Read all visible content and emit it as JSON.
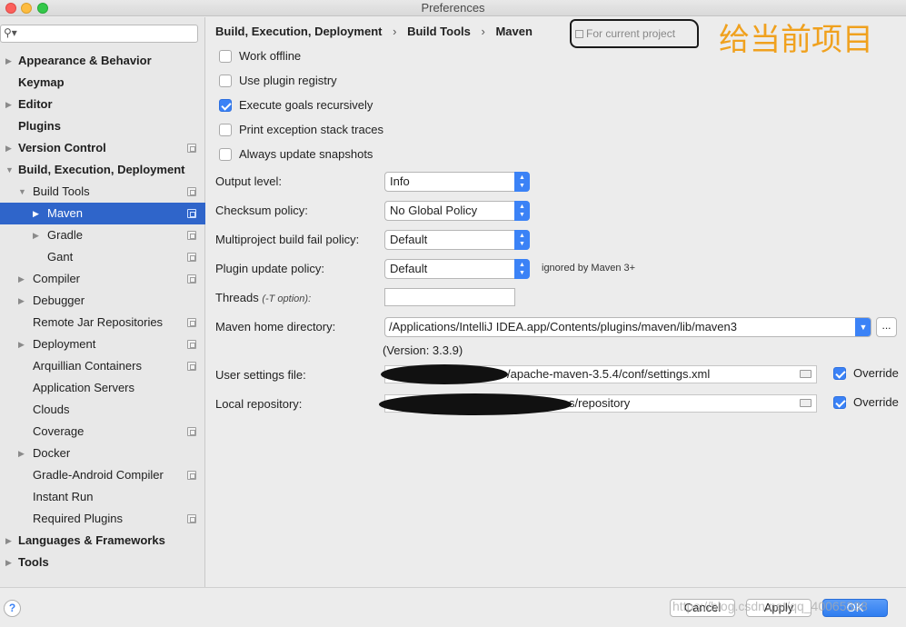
{
  "window": {
    "title": "Preferences"
  },
  "search": {
    "placeholder": ""
  },
  "sidebar": {
    "items": [
      {
        "label": "Appearance & Behavior",
        "arrow": "▶",
        "bold": true,
        "indent": 0,
        "proj": false,
        "selected": false
      },
      {
        "label": "Keymap",
        "arrow": "",
        "bold": true,
        "indent": 0,
        "proj": false,
        "selected": false
      },
      {
        "label": "Editor",
        "arrow": "▶",
        "bold": true,
        "indent": 0,
        "proj": false,
        "selected": false
      },
      {
        "label": "Plugins",
        "arrow": "",
        "bold": true,
        "indent": 0,
        "proj": false,
        "selected": false
      },
      {
        "label": "Version Control",
        "arrow": "▶",
        "bold": true,
        "indent": 0,
        "proj": true,
        "selected": false
      },
      {
        "label": "Build, Execution, Deployment",
        "arrow": "▼",
        "bold": true,
        "indent": 0,
        "proj": false,
        "selected": false
      },
      {
        "label": "Build Tools",
        "arrow": "▼",
        "bold": false,
        "indent": 1,
        "proj": true,
        "selected": false
      },
      {
        "label": "Maven",
        "arrow": "▶",
        "bold": false,
        "indent": 2,
        "proj": true,
        "selected": true
      },
      {
        "label": "Gradle",
        "arrow": "▶",
        "bold": false,
        "indent": 2,
        "proj": true,
        "selected": false
      },
      {
        "label": "Gant",
        "arrow": "",
        "bold": false,
        "indent": 2,
        "proj": true,
        "selected": false
      },
      {
        "label": "Compiler",
        "arrow": "▶",
        "bold": false,
        "indent": 1,
        "proj": true,
        "selected": false
      },
      {
        "label": "Debugger",
        "arrow": "▶",
        "bold": false,
        "indent": 1,
        "proj": false,
        "selected": false
      },
      {
        "label": "Remote Jar Repositories",
        "arrow": "",
        "bold": false,
        "indent": 1,
        "proj": true,
        "selected": false
      },
      {
        "label": "Deployment",
        "arrow": "▶",
        "bold": false,
        "indent": 1,
        "proj": true,
        "selected": false
      },
      {
        "label": "Arquillian Containers",
        "arrow": "",
        "bold": false,
        "indent": 1,
        "proj": true,
        "selected": false
      },
      {
        "label": "Application Servers",
        "arrow": "",
        "bold": false,
        "indent": 1,
        "proj": false,
        "selected": false
      },
      {
        "label": "Clouds",
        "arrow": "",
        "bold": false,
        "indent": 1,
        "proj": false,
        "selected": false
      },
      {
        "label": "Coverage",
        "arrow": "",
        "bold": false,
        "indent": 1,
        "proj": true,
        "selected": false
      },
      {
        "label": "Docker",
        "arrow": "▶",
        "bold": false,
        "indent": 1,
        "proj": false,
        "selected": false
      },
      {
        "label": "Gradle-Android Compiler",
        "arrow": "",
        "bold": false,
        "indent": 1,
        "proj": true,
        "selected": false
      },
      {
        "label": "Instant Run",
        "arrow": "",
        "bold": false,
        "indent": 1,
        "proj": false,
        "selected": false
      },
      {
        "label": "Required Plugins",
        "arrow": "",
        "bold": false,
        "indent": 1,
        "proj": true,
        "selected": false
      },
      {
        "label": "Languages & Frameworks",
        "arrow": "▶",
        "bold": true,
        "indent": 0,
        "proj": false,
        "selected": false
      },
      {
        "label": "Tools",
        "arrow": "▶",
        "bold": true,
        "indent": 0,
        "proj": false,
        "selected": false
      }
    ]
  },
  "breadcrumb": {
    "part1": "Build, Execution, Deployment",
    "part2": "Build Tools",
    "part3": "Maven",
    "sep": "›"
  },
  "scope": {
    "label": "For current project"
  },
  "annotation": {
    "text": "给当前项目"
  },
  "options": {
    "work_offline": "Work offline",
    "use_plugin_registry": "Use plugin registry",
    "execute_goals_recursively": "Execute goals recursively",
    "print_exception_stack_traces": "Print exception stack traces",
    "always_update_snapshots": "Always update snapshots"
  },
  "fields": {
    "output_level": {
      "label": "Output level:",
      "value": "Info"
    },
    "checksum_policy": {
      "label": "Checksum policy:",
      "value": "No Global Policy"
    },
    "multiproject_fail_policy": {
      "label": "Multiproject build fail policy:",
      "value": "Default"
    },
    "plugin_update_policy": {
      "label": "Plugin update policy:",
      "value": "Default",
      "hint": "ignored by Maven 3+"
    },
    "threads": {
      "label": "Threads",
      "hint": "(-T option):",
      "value": ""
    },
    "maven_home": {
      "label": "Maven home directory:",
      "value": "/Applications/IntelliJ IDEA.app/Contents/plugins/maven/lib/maven3",
      "browse": "..."
    },
    "version": "(Version: 3.3.9)",
    "user_settings": {
      "label": "User settings file:",
      "value": "/apache-maven-3.5.4/conf/settings.xml",
      "override": "Override"
    },
    "local_repo": {
      "label": "Local repository:",
      "value": "s/repository",
      "override": "Override"
    }
  },
  "footer": {
    "help": "?",
    "cancel": "Cancel",
    "apply": "Apply",
    "ok": "OK",
    "watermark": "https://blog.csdn.net/qq_40065338"
  },
  "colors": {
    "accent": "#3b82f6",
    "selection": "#2f65ca",
    "annotation": "#f0a11e"
  }
}
